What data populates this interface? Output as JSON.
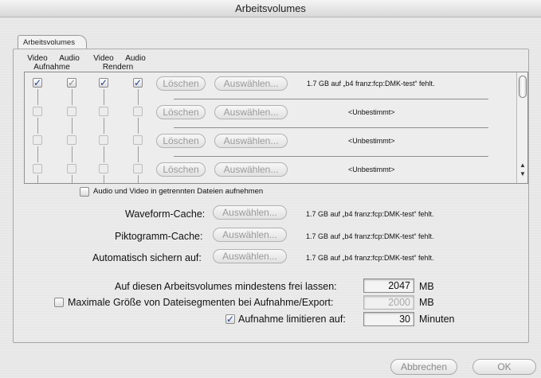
{
  "window": {
    "title": "Arbeitsvolumes"
  },
  "tab": {
    "label": "Arbeitsvolumes"
  },
  "columns": {
    "video_capture": "Video",
    "audio_capture": "Audio",
    "capture_group": "Aufnahme",
    "video_render": "Video",
    "audio_render": "Audio",
    "render_group": "Rendern"
  },
  "volumes": [
    {
      "clear_label": "Löschen",
      "choose_label": "Auswählen...",
      "status": "1.7 GB auf „b4 franz:fcp:DMK-test“ fehlt.",
      "checks": [
        "✓",
        "✓",
        "✓",
        "✓"
      ]
    },
    {
      "clear_label": "Löschen",
      "choose_label": "Auswählen...",
      "status": "<Unbestimmt>"
    },
    {
      "clear_label": "Löschen",
      "choose_label": "Auswählen...",
      "status": "<Unbestimmt>"
    },
    {
      "clear_label": "Löschen",
      "choose_label": "Auswählen...",
      "status": "<Unbestimmt>"
    }
  ],
  "separate_files": {
    "label": "Audio und Video in getrennten Dateien aufnehmen"
  },
  "caches": [
    {
      "label": "Waveform-Cache:",
      "button": "Auswählen...",
      "status": "1.7 GB auf „b4 franz:fcp:DMK-test“ fehlt."
    },
    {
      "label": "Piktogramm-Cache:",
      "button": "Auswählen...",
      "status": "1.7 GB auf „b4 franz:fcp:DMK-test“ fehlt."
    },
    {
      "label": "Automatisch sichern auf:",
      "button": "Auswählen...",
      "status": "1.7 GB auf „b4 franz:fcp:DMK-test“ fehlt."
    }
  ],
  "min_free": {
    "label": "Auf diesen Arbeitsvolumes mindestens frei lassen:",
    "value": "2047",
    "unit": "MB"
  },
  "max_segment": {
    "label": "Maximale Größe von Dateisegmenten bei Aufnahme/Export:",
    "value": "2000",
    "unit": "MB"
  },
  "limit_capture": {
    "label": "Aufnahme limitieren auf:",
    "value": "30",
    "unit": "Minuten",
    "check": "✓"
  },
  "footer": {
    "cancel": "Abbrechen",
    "ok": "OK"
  },
  "colors": {
    "accent_check": "#1c3f94"
  }
}
